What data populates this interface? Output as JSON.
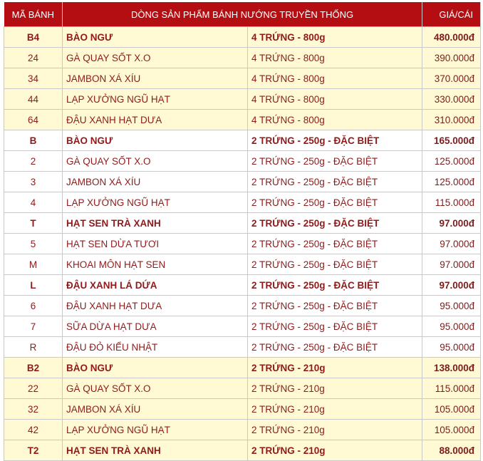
{
  "table": {
    "headers": {
      "code": "MÃ BÁNH",
      "name": "DÒNG SẢN PHẨM BÁNH NƯỚNG TRUYỀN THỐNG",
      "price": "GIÁ/CÁI"
    },
    "rows": [
      {
        "code": "B4",
        "name": "BÀO NGƯ",
        "spec": "4 TRỨNG - 800g",
        "price": "480.000đ",
        "bold": true,
        "bg": "y"
      },
      {
        "code": "24",
        "name": "GÀ QUAY SỐT X.O",
        "spec": "4 TRỨNG - 800g",
        "price": "390.000đ",
        "bold": false,
        "bg": "y"
      },
      {
        "code": "34",
        "name": "JAMBON XÁ XÍU",
        "spec": "4 TRỨNG - 800g",
        "price": "370.000đ",
        "bold": false,
        "bg": "y"
      },
      {
        "code": "44",
        "name": "LẠP XƯỞNG NGŨ HẠT",
        "spec": "4 TRỨNG - 800g",
        "price": "330.000đ",
        "bold": false,
        "bg": "y"
      },
      {
        "code": "64",
        "name": "ĐẬU XANH HẠT DƯA",
        "spec": "4 TRỨNG - 800g",
        "price": "310.000đ",
        "bold": false,
        "bg": "y"
      },
      {
        "code": "B",
        "name": "BÀO NGƯ",
        "spec": "2 TRỨNG - 250g - ĐẶC BIỆT",
        "price": "165.000đ",
        "bold": true,
        "bg": "w"
      },
      {
        "code": "2",
        "name": "GÀ QUAY SỐT X.O",
        "spec": "2 TRỨNG - 250g - ĐẶC BIỆT",
        "price": "125.000đ",
        "bold": false,
        "bg": "w"
      },
      {
        "code": "3",
        "name": "JAMBON XÁ XÍU",
        "spec": "2 TRỨNG - 250g - ĐẶC BIỆT",
        "price": "125.000đ",
        "bold": false,
        "bg": "w"
      },
      {
        "code": "4",
        "name": "LẠP XƯỞNG NGŨ HẠT",
        "spec": "2 TRỨNG - 250g - ĐẶC BIỆT",
        "price": "115.000đ",
        "bold": false,
        "bg": "w"
      },
      {
        "code": "T",
        "name": "HẠT SEN TRÀ XANH",
        "spec": "2 TRỨNG - 250g - ĐẶC BIỆT",
        "price": "97.000đ",
        "bold": true,
        "bg": "w"
      },
      {
        "code": "5",
        "name": "HẠT SEN DỪA TƯƠI",
        "spec": "2 TRỨNG - 250g - ĐẶC BIỆT",
        "price": "97.000đ",
        "bold": false,
        "bg": "w"
      },
      {
        "code": "M",
        "name": "KHOAI MÔN HẠT SEN",
        "spec": "2 TRỨNG - 250g - ĐẶC BIỆT",
        "price": "97.000đ",
        "bold": false,
        "bg": "w"
      },
      {
        "code": "L",
        "name": "ĐẬU XANH LÁ DỨA",
        "spec": "2 TRỨNG - 250g - ĐẶC BIỆT",
        "price": "97.000đ",
        "bold": true,
        "bg": "w"
      },
      {
        "code": "6",
        "name": "ĐẬU XANH HẠT DƯA",
        "spec": "2 TRỨNG - 250g - ĐẶC BIỆT",
        "price": "95.000đ",
        "bold": false,
        "bg": "w"
      },
      {
        "code": "7",
        "name": "SỮA DỪA HẠT DƯA",
        "spec": "2 TRỨNG - 250g - ĐẶC BIỆT",
        "price": "95.000đ",
        "bold": false,
        "bg": "w"
      },
      {
        "code": "R",
        "name": "ĐẬU ĐỎ KIỂU NHẬT",
        "spec": "2 TRỨNG - 250g - ĐẶC BIỆT",
        "price": "95.000đ",
        "bold": false,
        "bg": "w"
      },
      {
        "code": "B2",
        "name": "BÀO NGƯ",
        "spec": "2 TRỨNG - 210g",
        "price": "138.000đ",
        "bold": true,
        "bg": "y"
      },
      {
        "code": "22",
        "name": "GÀ QUAY SỐT X.O",
        "spec": "2 TRỨNG - 210g",
        "price": "115.000đ",
        "bold": false,
        "bg": "y"
      },
      {
        "code": "32",
        "name": "JAMBON XÁ XÍU",
        "spec": "2 TRỨNG - 210g",
        "price": "105.000đ",
        "bold": false,
        "bg": "y"
      },
      {
        "code": "42",
        "name": "LẠP XƯỞNG NGŨ HẠT",
        "spec": "2 TRỨNG - 210g",
        "price": "105.000đ",
        "bold": false,
        "bg": "y"
      },
      {
        "code": "T2",
        "name": "HẠT SEN TRÀ XANH",
        "spec": "2 TRỨNG - 210g",
        "price": "88.000đ",
        "bold": true,
        "bg": "y"
      }
    ]
  },
  "colors": {
    "header_bg": "#b50e12",
    "header_text": "#ffffff",
    "row_yellow": "#fff9d4",
    "row_white": "#ffffff",
    "text": "#8e1b1b"
  }
}
